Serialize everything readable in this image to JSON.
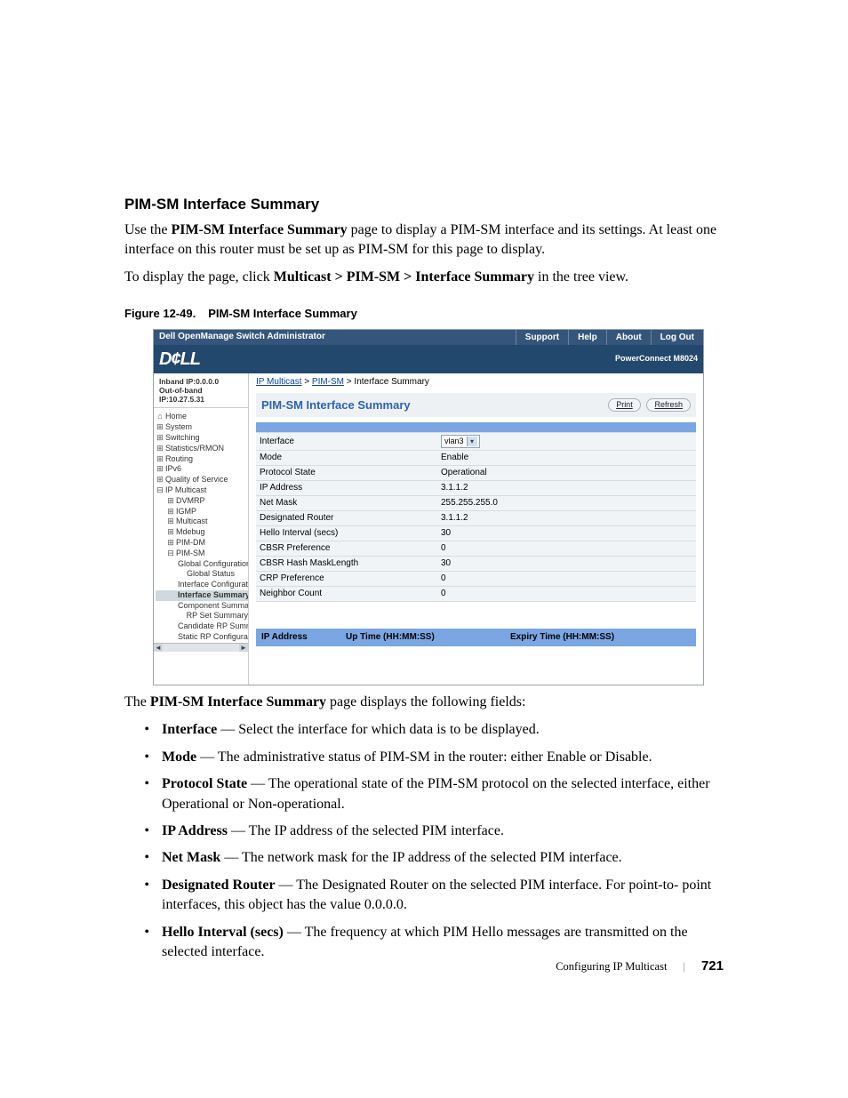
{
  "section_title": "PIM-SM Interface Summary",
  "intro": {
    "line1_pre": "Use the ",
    "line1_bold": "PIM-SM Interface Summary",
    "line1_post": " page to display a PIM-SM interface and its settings. At least one interface on this router must be set up as PIM-SM for this page to display.",
    "line2_pre": "To display the page, click ",
    "line2_bold": "Multicast > PIM-SM > Interface Summary",
    "line2_post": " in the tree view."
  },
  "figure": {
    "label": "Figure 12-49.",
    "caption": "PIM-SM Interface Summary"
  },
  "shot": {
    "topbar": {
      "title": "Dell OpenManage Switch Administrator",
      "links": [
        "Support",
        "Help",
        "About",
        "Log Out"
      ]
    },
    "logo": "D¢LL",
    "model": "PowerConnect M8024",
    "side": {
      "inband": "Inband IP:0.0.0.0",
      "oob": "Out-of-band IP:10.27.5.31",
      "items": [
        {
          "lv": 1,
          "ic": "home",
          "label": "Home"
        },
        {
          "lv": 1,
          "ic": "+",
          "label": "System"
        },
        {
          "lv": 1,
          "ic": "+",
          "label": "Switching"
        },
        {
          "lv": 1,
          "ic": "+",
          "label": "Statistics/RMON"
        },
        {
          "lv": 1,
          "ic": "+",
          "label": "Routing"
        },
        {
          "lv": 1,
          "ic": "+",
          "label": "IPv6"
        },
        {
          "lv": 1,
          "ic": "+",
          "label": "Quality of Service"
        },
        {
          "lv": 1,
          "ic": "-",
          "label": "IP Multicast"
        },
        {
          "lv": 2,
          "ic": "+",
          "label": "DVMRP"
        },
        {
          "lv": 2,
          "ic": "+",
          "label": "IGMP"
        },
        {
          "lv": 2,
          "ic": "+",
          "label": "Multicast"
        },
        {
          "lv": 2,
          "ic": "+",
          "label": "Mdebug"
        },
        {
          "lv": 2,
          "ic": "+",
          "label": "PIM-DM"
        },
        {
          "lv": 2,
          "ic": "-",
          "label": "PIM-SM"
        },
        {
          "lv": 3,
          "ic": "",
          "label": "Global Configuration"
        },
        {
          "lv": 3,
          "ic": "",
          "label": "Global Status"
        },
        {
          "lv": 3,
          "ic": "",
          "label": "Interface Configuration"
        },
        {
          "lv": 3,
          "ic": "",
          "label": "Interface Summary",
          "sel": true
        },
        {
          "lv": 3,
          "ic": "",
          "label": "Component Summary"
        },
        {
          "lv": 3,
          "ic": "",
          "label": "RP Set Summary"
        },
        {
          "lv": 3,
          "ic": "",
          "label": "Candidate RP Summ"
        },
        {
          "lv": 3,
          "ic": "",
          "label": "Static RP Configurati"
        }
      ]
    },
    "crumbs": {
      "a": "IP Multicast",
      "b": "PIM-SM",
      "c": "Interface Summary",
      "sep": " > "
    },
    "panel_title": "PIM-SM Interface Summary",
    "buttons": {
      "print": "Print",
      "refresh": "Refresh"
    },
    "kv": [
      {
        "k": "Interface",
        "v": "vlan3",
        "select": true
      },
      {
        "k": "Mode",
        "v": "Enable"
      },
      {
        "k": "Protocol State",
        "v": "Operational"
      },
      {
        "k": "IP Address",
        "v": "3.1.1.2"
      },
      {
        "k": "Net Mask",
        "v": "255.255.255.0"
      },
      {
        "k": "Designated Router",
        "v": "3.1.1.2"
      },
      {
        "k": "Hello Interval (secs)",
        "v": "30"
      },
      {
        "k": "CBSR Preference",
        "v": "0"
      },
      {
        "k": "CBSR Hash MaskLength",
        "v": "30"
      },
      {
        "k": "CRP Preference",
        "v": "0"
      },
      {
        "k": "Neighbor Count",
        "v": "0"
      }
    ],
    "hdr": {
      "a": "IP Address",
      "b": "Up Time (HH:MM:SS)",
      "c": "Expiry Time (HH:MM:SS)"
    }
  },
  "aftershot": {
    "lead_pre": "The ",
    "lead_bold": "PIM-SM Interface Summary",
    "lead_post": " page displays the following fields:"
  },
  "fields": [
    {
      "name": "Interface",
      "desc": "Select the interface for which data is to be displayed."
    },
    {
      "name": "Mode",
      "desc": "The administrative status of PIM-SM in the router: either Enable or Disable."
    },
    {
      "name": "Protocol State",
      "desc": "The operational state of the PIM-SM protocol on the selected interface, either Operational or Non-operational."
    },
    {
      "name": "IP Address",
      "desc": "The IP address of the selected PIM interface."
    },
    {
      "name": "Net Mask",
      "desc": "The network mask for the IP address of the selected PIM interface."
    },
    {
      "name": "Designated Router",
      "desc": "The Designated Router on the selected PIM interface. For point-to- point interfaces, this object has the value 0.0.0.0."
    },
    {
      "name": "Hello Interval (secs)",
      "desc": "The frequency at which PIM Hello messages are transmitted on the selected interface."
    }
  ],
  "dash": " — ",
  "footer": {
    "chapter": "Configuring IP Multicast",
    "page": "721"
  }
}
